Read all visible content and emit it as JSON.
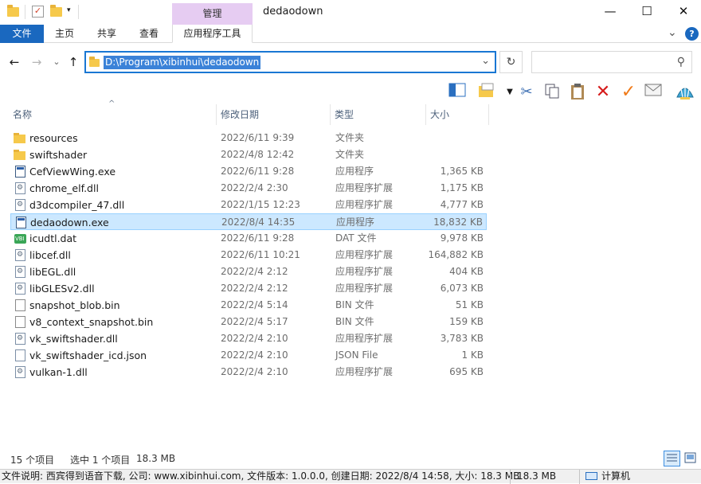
{
  "window": {
    "title": "dedaodown",
    "context_tab": "管理",
    "minimize": "—",
    "maximize": "☐",
    "close": "✕"
  },
  "ribbon": {
    "tabs": [
      {
        "label": "文件"
      },
      {
        "label": "主页"
      },
      {
        "label": "共享"
      },
      {
        "label": "查看"
      },
      {
        "label": "应用程序工具"
      }
    ],
    "expand": "⌄",
    "help": "?"
  },
  "nav": {
    "back": "←",
    "forward": "→",
    "recent": "⌄",
    "up": "↑",
    "address": "D:\\Program\\xibinhui\\dedaodown",
    "dropdown": "⌄",
    "refresh": "↻",
    "search_icon": "⚲"
  },
  "columns": {
    "name": "名称",
    "date": "修改日期",
    "type": "类型",
    "size": "大小"
  },
  "files": [
    {
      "name": "resources",
      "date": "2022/6/11 9:39",
      "type": "文件夹",
      "size": "",
      "icon": "folder-icon"
    },
    {
      "name": "swiftshader",
      "date": "2022/4/8 12:42",
      "type": "文件夹",
      "size": "",
      "icon": "folder-icon"
    },
    {
      "name": "CefViewWing.exe",
      "date": "2022/6/11 9:28",
      "type": "应用程序",
      "size": "1,365 KB",
      "icon": "exe-icon"
    },
    {
      "name": "chrome_elf.dll",
      "date": "2022/2/4 2:30",
      "type": "应用程序扩展",
      "size": "1,175 KB",
      "icon": "dll-icon"
    },
    {
      "name": "d3dcompiler_47.dll",
      "date": "2022/1/15 12:23",
      "type": "应用程序扩展",
      "size": "4,777 KB",
      "icon": "dll-icon"
    },
    {
      "name": "dedaodown.exe",
      "date": "2022/8/4 14:35",
      "type": "应用程序",
      "size": "18,832 KB",
      "icon": "app-icon",
      "selected": true
    },
    {
      "name": "icudtl.dat",
      "date": "2022/6/11 9:28",
      "type": "DAT 文件",
      "size": "9,978 KB",
      "icon": "dat-icon"
    },
    {
      "name": "libcef.dll",
      "date": "2022/6/11 10:21",
      "type": "应用程序扩展",
      "size": "164,882 KB",
      "icon": "dll-icon"
    },
    {
      "name": "libEGL.dll",
      "date": "2022/2/4 2:12",
      "type": "应用程序扩展",
      "size": "404 KB",
      "icon": "dll-icon"
    },
    {
      "name": "libGLESv2.dll",
      "date": "2022/2/4 2:12",
      "type": "应用程序扩展",
      "size": "6,073 KB",
      "icon": "dll-icon"
    },
    {
      "name": "snapshot_blob.bin",
      "date": "2022/2/4 5:14",
      "type": "BIN 文件",
      "size": "51 KB",
      "icon": "bin-icon"
    },
    {
      "name": "v8_context_snapshot.bin",
      "date": "2022/2/4 5:17",
      "type": "BIN 文件",
      "size": "159 KB",
      "icon": "bin-icon"
    },
    {
      "name": "vk_swiftshader.dll",
      "date": "2022/2/4 2:10",
      "type": "应用程序扩展",
      "size": "3,783 KB",
      "icon": "dll-icon"
    },
    {
      "name": "vk_swiftshader_icd.json",
      "date": "2022/2/4 2:10",
      "type": "JSON File",
      "size": "1 KB",
      "icon": "json-icon"
    },
    {
      "name": "vulkan-1.dll",
      "date": "2022/2/4 2:10",
      "type": "应用程序扩展",
      "size": "695 KB",
      "icon": "dll-icon"
    }
  ],
  "status": {
    "count": "15 个项目",
    "selected": "选中 1 个项目",
    "selected_size": "18.3 MB"
  },
  "infobar": {
    "description": "文件说明: 西宾得到语音下载, 公司: www.xibinhui.com, 文件版本: 1.0.0.0, 创建日期: 2022/8/4 14:58, 大小: 18.3 MB",
    "size": "18.3 MB",
    "location": "计算机"
  },
  "colors": {
    "accent": "#1a68bf",
    "selection": "#cce8ff",
    "context_tab": "#e6ccf2"
  }
}
